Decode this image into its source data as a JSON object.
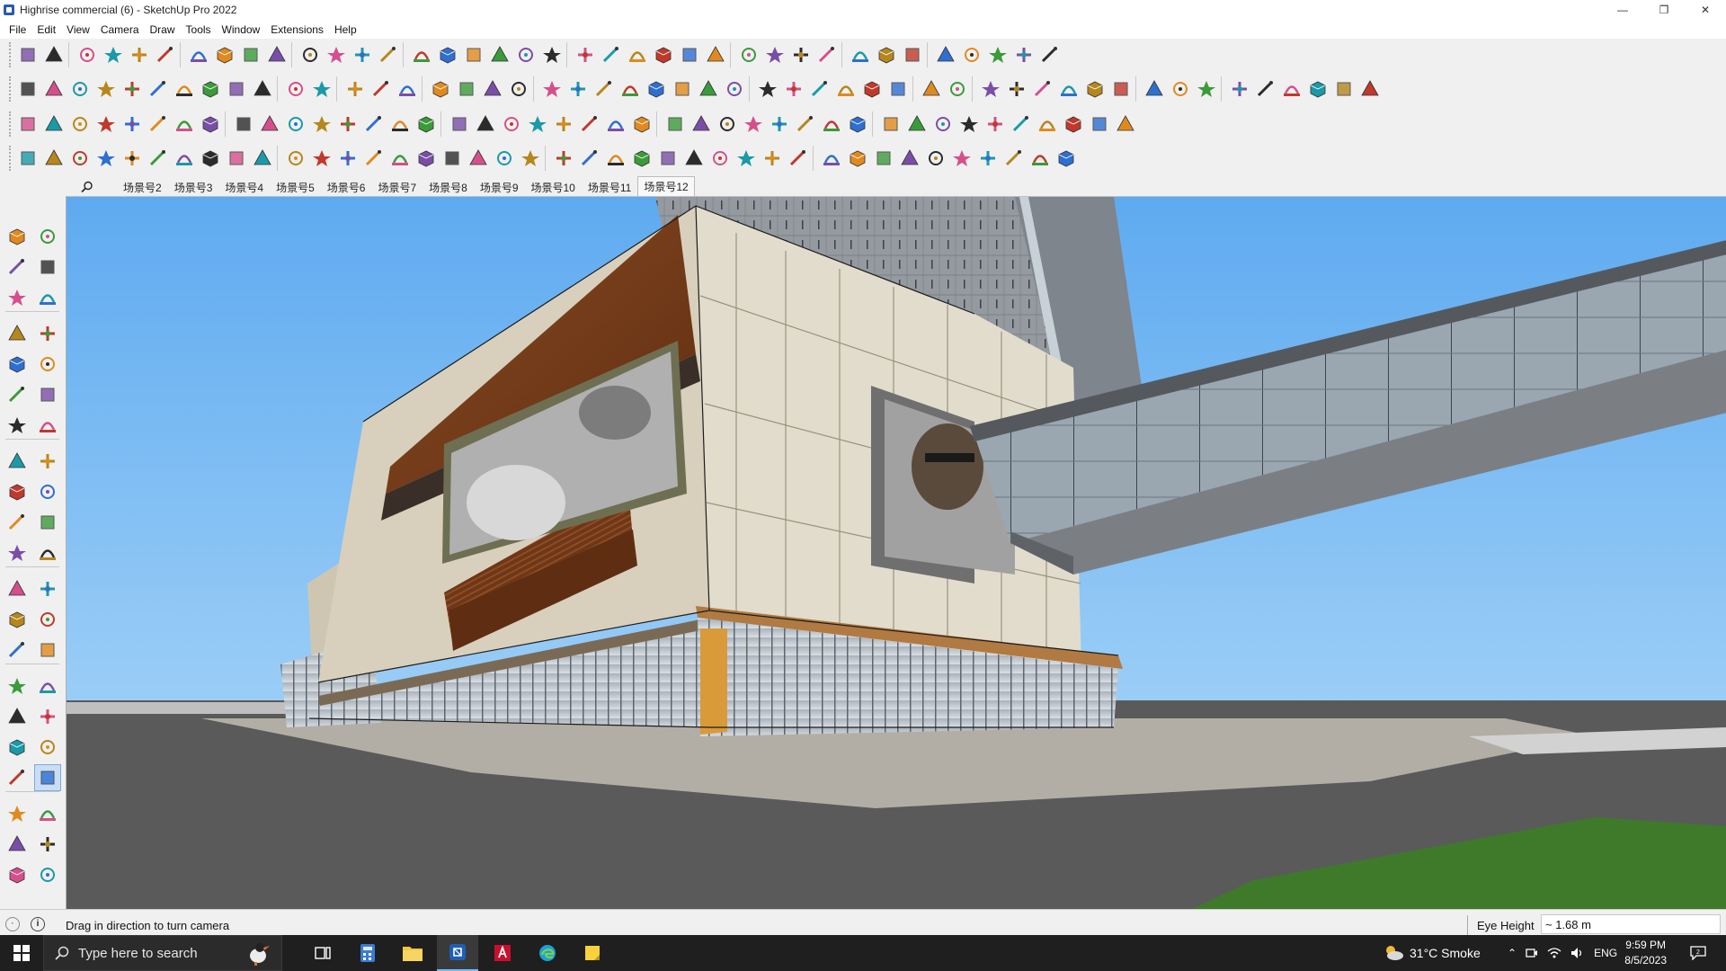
{
  "window": {
    "title": "Highrise commercial (6) - SketchUp Pro 2022",
    "controls": [
      "minimize-icon",
      "restore-icon",
      "close-icon"
    ]
  },
  "menu": [
    "File",
    "Edit",
    "View",
    "Camera",
    "Draw",
    "Tools",
    "Window",
    "Extensions",
    "Help"
  ],
  "scenes": {
    "tabs": [
      "场景号2",
      "场景号3",
      "场景号4",
      "场景号5",
      "场景号6",
      "场景号7",
      "场景号8",
      "场景号9",
      "场景号10",
      "场景号11",
      "场景号12"
    ],
    "active": "场景号12"
  },
  "left_tools": [
    "select",
    "orbit",
    "paint-bucket",
    "eraser",
    "component",
    "tape-measure",
    "line",
    "freehand",
    "rectangle",
    "rotated-rectangle",
    "circle",
    "polygon",
    "arc",
    "two-point-arc",
    "pie",
    "three-point-arc",
    "move",
    "push-pull",
    "rotate",
    "follow-me",
    "scale",
    "offset",
    "tape",
    "text",
    "protractor",
    "3d-text",
    "axes",
    "dimension",
    "orbit",
    "pan",
    "zoom",
    "zoom-window",
    "zoom-extents",
    "position-camera",
    "walk",
    "look-around",
    "section-plane",
    "footprints",
    "sandbox-from-contours",
    "sandbox-from-scratch",
    "drape",
    "stamp"
  ],
  "status": {
    "hint": "Drag in direction to turn camera",
    "measure_label": "Eye Height",
    "measure_value": "~ 1.68 m"
  },
  "taskbar": {
    "search_placeholder": "Type here to search",
    "weather": "31°C  Smoke",
    "language": "ENG",
    "time": "9:59 PM",
    "date": "8/5/2023"
  },
  "colors": {
    "sky": "#73b8f0",
    "ground": "#5a5a5a",
    "grass": "#3f7a2a",
    "facade_stone": "#e2dccd",
    "wood_slats": "#7a3f1c",
    "glass_tower": "#8e949a",
    "taskbar": "#1f1f1f"
  }
}
